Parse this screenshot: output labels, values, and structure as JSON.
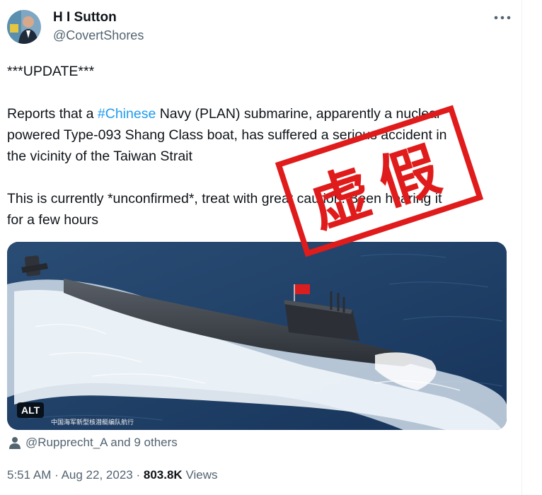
{
  "tweet": {
    "author_name": "H I Sutton",
    "author_handle": "@CovertShores",
    "body": {
      "line_update": "***UPDATE***",
      "p1_part1": "Reports that a ",
      "p1_hashtag": "#Chinese",
      "p1_part2": " Navy (PLAN) submarine, apparently a nuclear",
      "p1_line2": "powered Type-093 Shang Class boat, has suffered a serious accident in",
      "p1_line3": "the vicinity of the Taiwan Strait",
      "p2_line1": "This is currently *unconfirmed*, treat with great caution. Been hearing it",
      "p2_line2": "for a few hours"
    },
    "media": {
      "alt_badge": "ALT",
      "caption": "中国海军新型核潜艇编队航行"
    },
    "tagged_users": "@Rupprecht_A and 9 others",
    "time": "5:51 AM",
    "date": "Aug 22, 2023",
    "views_count": "803.8K",
    "views_label": "Views",
    "separator": "·"
  },
  "stamp": {
    "text": "虚假"
  },
  "colors": {
    "accent": "#1d9bf0",
    "stamp": "#e01b1b",
    "secondary_text": "#536471"
  },
  "icons": [
    "more-icon",
    "person-icon"
  ]
}
